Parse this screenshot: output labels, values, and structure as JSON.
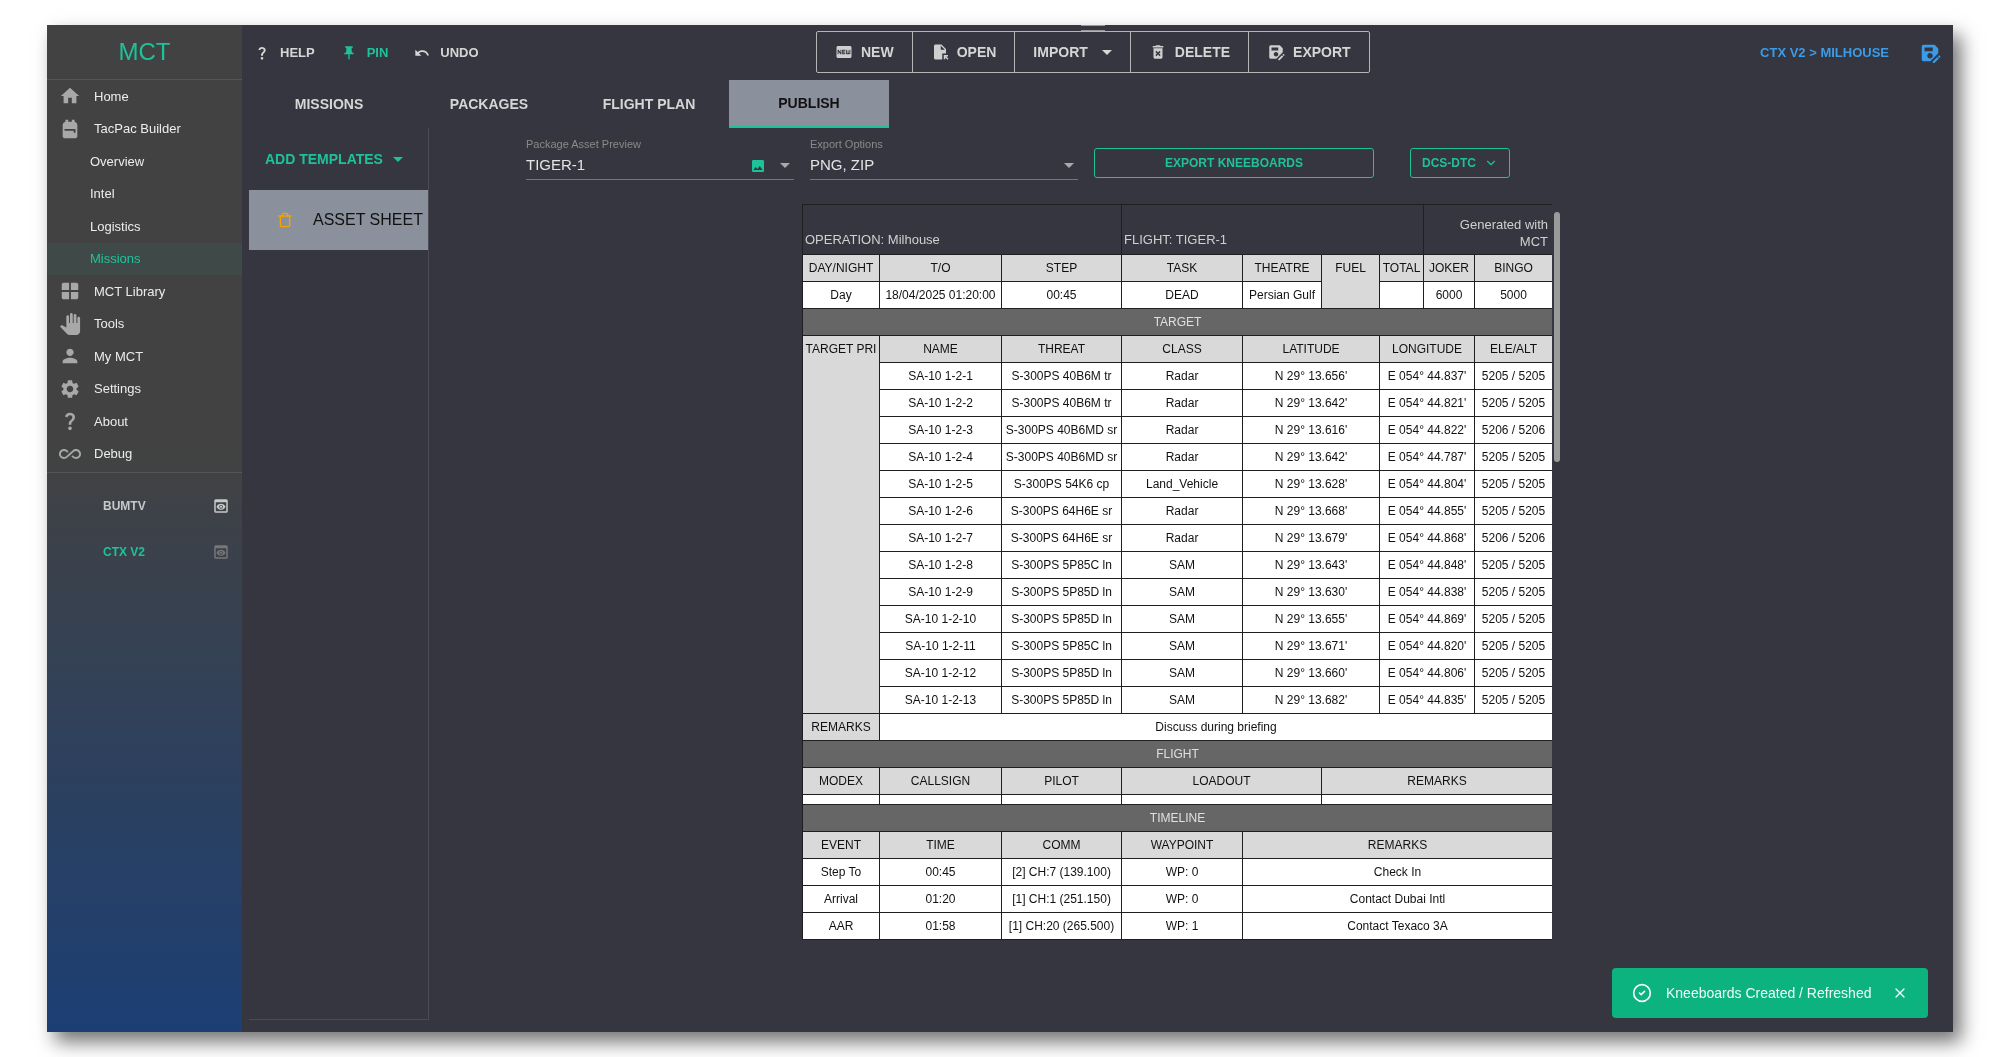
{
  "logo": "MCT",
  "sidebar": {
    "items": [
      {
        "label": "Home",
        "kind": "main",
        "selected": false
      },
      {
        "label": "TacPac Builder",
        "kind": "main",
        "selected": false
      },
      {
        "label": "Overview",
        "kind": "sub",
        "selected": false
      },
      {
        "label": "Intel",
        "kind": "sub",
        "selected": false
      },
      {
        "label": "Logistics",
        "kind": "sub",
        "selected": false
      },
      {
        "label": "Missions",
        "kind": "sub",
        "selected": true
      },
      {
        "label": "MCT Library",
        "kind": "main",
        "selected": false
      },
      {
        "label": "Tools",
        "kind": "main",
        "selected": false
      },
      {
        "label": "My MCT",
        "kind": "main",
        "selected": false
      },
      {
        "label": "Settings",
        "kind": "main",
        "selected": false
      },
      {
        "label": "About",
        "kind": "main",
        "selected": false
      },
      {
        "label": "Debug",
        "kind": "main",
        "selected": false
      }
    ],
    "campaigns": [
      {
        "label": "BUMTV",
        "selected": false
      },
      {
        "label": "CTX V2",
        "selected": true
      }
    ]
  },
  "toolbar": [
    {
      "label": "HELP",
      "active": false
    },
    {
      "label": "PIN",
      "active": true
    },
    {
      "label": "UNDO",
      "active": false
    }
  ],
  "file_buttons": [
    {
      "label": "NEW",
      "dropdown": false
    },
    {
      "label": "OPEN",
      "dropdown": false
    },
    {
      "label": "IMPORT",
      "dropdown": true
    },
    {
      "label": "DELETE",
      "dropdown": false
    },
    {
      "label": "EXPORT",
      "dropdown": false
    }
  ],
  "breadcrumb": "CTX V2 > MILHOUSE",
  "tabs": [
    {
      "label": "MISSIONS",
      "selected": false
    },
    {
      "label": "PACKAGES",
      "selected": false
    },
    {
      "label": "FLIGHT PLAN",
      "selected": false
    },
    {
      "label": "PUBLISH",
      "selected": true
    }
  ],
  "add_templates": "ADD TEMPLATES",
  "templates": [
    {
      "label": "ASSET SHEET",
      "selected": true
    }
  ],
  "package_preview": {
    "label": "Package Asset Preview",
    "value": "TIGER-1"
  },
  "export_options": {
    "label": "Export Options",
    "value": "PNG, ZIP"
  },
  "export_button": "EXPORT KNEEBOARDS",
  "dtc_button": "DCS-DTC",
  "kneeboard": {
    "operation": "OPERATION: Milhouse",
    "flight": "FLIGHT: TIGER-1",
    "generated": "Generated with MCT",
    "summary": [
      {
        "label": "DAY/NIGHT",
        "kind": "plain",
        "value": "Day"
      },
      {
        "label": "T/O",
        "kind": "plain",
        "value": "18/04/2025 01:20:00"
      },
      {
        "label": "STEP",
        "kind": "plain",
        "value": "00:45"
      },
      {
        "label": "TASK",
        "kind": "plain",
        "value": "DEAD"
      },
      {
        "label": "THEATRE",
        "kind": "plain",
        "value": "Persian Gulf"
      },
      {
        "label": "FUEL",
        "kind": "merged"
      },
      {
        "label": "TOTAL",
        "kind": "plain"
      },
      {
        "label": "JOKER",
        "kind": "plain",
        "value": "6000"
      },
      {
        "label": "BINGO",
        "kind": "plain",
        "value": "5000"
      }
    ],
    "target": {
      "title": "TARGET",
      "label": "TARGET PRI",
      "columns": [
        "NAME",
        "THREAT",
        "CLASS",
        "LATITUDE",
        "LONGITUDE",
        "ELE/ALT"
      ],
      "rows": [
        [
          "SA-10 1-2-1",
          "S-300PS 40B6M tr",
          "Radar",
          "N 29° 13.656'",
          "E 054° 44.837'",
          "5205 / 5205"
        ],
        [
          "SA-10 1-2-2",
          "S-300PS 40B6M tr",
          "Radar",
          "N 29° 13.642'",
          "E 054° 44.821'",
          "5205 / 5205"
        ],
        [
          "SA-10 1-2-3",
          "S-300PS 40B6MD sr",
          "Radar",
          "N 29° 13.616'",
          "E 054° 44.822'",
          "5206 / 5206"
        ],
        [
          "SA-10 1-2-4",
          "S-300PS 40B6MD sr",
          "Radar",
          "N 29° 13.642'",
          "E 054° 44.787'",
          "5205 / 5205"
        ],
        [
          "SA-10 1-2-5",
          "S-300PS 54K6 cp",
          "Land_Vehicle",
          "N 29° 13.628'",
          "E 054° 44.804'",
          "5205 / 5205"
        ],
        [
          "SA-10 1-2-6",
          "S-300PS 64H6E sr",
          "Radar",
          "N 29° 13.668'",
          "E 054° 44.855'",
          "5205 / 5205"
        ],
        [
          "SA-10 1-2-7",
          "S-300PS 64H6E sr",
          "Radar",
          "N 29° 13.679'",
          "E 054° 44.868'",
          "5206 / 5206"
        ],
        [
          "SA-10 1-2-8",
          "S-300PS 5P85C ln",
          "SAM",
          "N 29° 13.643'",
          "E 054° 44.848'",
          "5205 / 5205"
        ],
        [
          "SA-10 1-2-9",
          "S-300PS 5P85D ln",
          "SAM",
          "N 29° 13.630'",
          "E 054° 44.838'",
          "5205 / 5205"
        ],
        [
          "SA-10 1-2-10",
          "S-300PS 5P85D ln",
          "SAM",
          "N 29° 13.655'",
          "E 054° 44.869'",
          "5205 / 5205"
        ],
        [
          "SA-10 1-2-11",
          "S-300PS 5P85C ln",
          "SAM",
          "N 29° 13.671'",
          "E 054° 44.820'",
          "5205 / 5205"
        ],
        [
          "SA-10 1-2-12",
          "S-300PS 5P85D ln",
          "SAM",
          "N 29° 13.660'",
          "E 054° 44.806'",
          "5205 / 5205"
        ],
        [
          "SA-10 1-2-13",
          "S-300PS 5P85D ln",
          "SAM",
          "N 29° 13.682'",
          "E 054° 44.835'",
          "5205 / 5205"
        ]
      ],
      "remarks_label": "REMARKS",
      "remarks": "Discuss during briefing"
    },
    "flight_section": {
      "title": "FLIGHT",
      "columns": [
        "MODEX",
        "CALLSIGN",
        "PILOT",
        "LOADOUT",
        "REMARKS"
      ]
    },
    "timeline": {
      "title": "TIMELINE",
      "columns": [
        "EVENT",
        "TIME",
        "COMM",
        "WAYPOINT",
        "REMARKS"
      ],
      "rows": [
        [
          "Step To",
          "00:45",
          "[2] CH:7 (139.100)",
          "WP: 0",
          "Check In"
        ],
        [
          "Arrival",
          "01:20",
          "[1] CH:1 (251.150)",
          "WP: 0",
          "Contact Dubai Intl"
        ],
        [
          "AAR",
          "01:58",
          "[1] CH:20 (265.500)",
          "WP: 1",
          "Contact Texaco 3A"
        ]
      ]
    }
  },
  "toast": {
    "message": "Kneeboards Created / Refreshed"
  }
}
